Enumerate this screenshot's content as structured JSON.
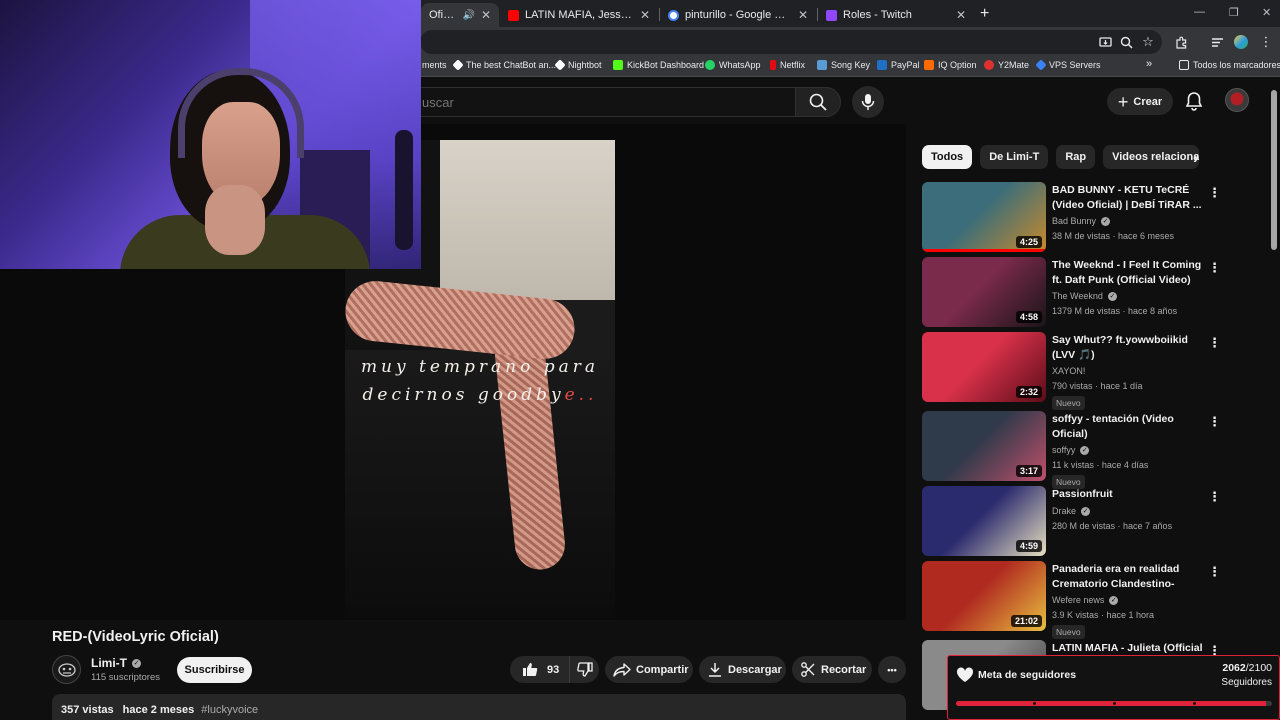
{
  "browser": {
    "tabs": [
      {
        "title": "Oficial) - Yo",
        "active": true,
        "fav_color": "#ff0000"
      },
      {
        "title": "LATIN MAFIA, Jesse Baez - Se fue",
        "active": false,
        "fav_color": "#ff0000"
      },
      {
        "title": "pinturillo - Google Search",
        "active": false,
        "fav_color": "#4285f4"
      },
      {
        "title": "Roles - Twitch",
        "active": false,
        "fav_color": "#9146ff"
      }
    ],
    "new_tab": "+",
    "window_controls": [
      "—",
      "❐",
      "✕"
    ],
    "bookmarks": [
      {
        "label": "ments",
        "color": "#35363a"
      },
      {
        "label": "The best ChatBot an...",
        "color": "#ffffff"
      },
      {
        "label": "Nightbot",
        "color": "#ffffff"
      },
      {
        "label": "KickBot Dashboard",
        "color": "#53fc18"
      },
      {
        "label": "WhatsApp",
        "color": "#25d366"
      },
      {
        "label": "Netflix",
        "color": "#e50914"
      },
      {
        "label": "Song Key",
        "color": "#5b9bd5"
      },
      {
        "label": "PayPal",
        "color": "#1f6fc5"
      },
      {
        "label": "IQ Option",
        "color": "#ff6b00"
      },
      {
        "label": "Y2Mate",
        "color": "#e03131"
      },
      {
        "label": "VPS Servers",
        "color": "#3b82f6"
      },
      {
        "label": "»",
        "color": "#35363a"
      },
      {
        "label": "Todos los marcadores",
        "color": "#35363a"
      }
    ]
  },
  "youtube": {
    "search_placeholder": "uscar",
    "create_label": "Crear",
    "album_text_line1": "muy temprano para",
    "album_text_line2": "decirnos goodby",
    "album_text_line2_red": "e..",
    "video_title": "RED-(VideoLyric Oficial)",
    "channel_name": "Limi-T",
    "channel_subs": "115 suscriptores",
    "subscribe_label": "Suscribirse",
    "like_count": "93",
    "actions": {
      "share": "Compartir",
      "download": "Descargar",
      "clip": "Recortar",
      "more": "•••"
    },
    "description": {
      "views": "357 vistas",
      "age": "hace 2 meses",
      "tag": "#luckyvoice"
    },
    "chips": [
      {
        "label": "Todos",
        "selected": true
      },
      {
        "label": "De Limi-T",
        "selected": false
      },
      {
        "label": "Rap",
        "selected": false
      },
      {
        "label": "Videos relacionados",
        "selected": false
      }
    ],
    "recommendations": [
      {
        "title": "BAD BUNNY - KETU TeCRÉ (Video Oficial) | DeBÍ TiRAR ...",
        "channel": "Bad Bunny",
        "verified": true,
        "meta": "38 M de vistas · hace 6 meses",
        "duration": "4:25",
        "badge": "",
        "thumb": "#3b6e7a",
        "thumb2": "#c98a2b",
        "watched": 1.0
      },
      {
        "title": "The Weeknd - I Feel It Coming ft. Daft Punk (Official Video)",
        "channel": "The Weeknd",
        "verified": true,
        "meta": "1379 M de vistas · hace 8 años",
        "duration": "4:58",
        "badge": "",
        "thumb": "#7a2a4a",
        "thumb2": "#1a1418",
        "watched": 0
      },
      {
        "title": "Say Whut?? ft.yowwboiikid (LVV 🎵)",
        "channel": "XAYON!",
        "verified": false,
        "meta": "790 vistas · hace 1 día",
        "duration": "2:32",
        "badge": "Nuevo",
        "thumb": "#d9314a",
        "thumb2": "#5a0d18",
        "watched": 0
      },
      {
        "title": "soffyy - tentación (Video Oficial)",
        "channel": "soffyy",
        "verified": true,
        "meta": "11 k vistas · hace 4 días",
        "duration": "3:17",
        "badge": "Nuevo",
        "thumb": "#2f3a4a",
        "thumb2": "#c0506a",
        "watched": 0
      },
      {
        "title": "Passionfruit",
        "channel": "Drake",
        "verified": true,
        "meta": "280 M de vistas · hace 7 años",
        "duration": "4:59",
        "badge": "",
        "thumb": "#2a2a6e",
        "thumb2": "#e8e0c0",
        "watched": 0
      },
      {
        "title": "Panaderia era en realidad Crematorio Clandestino-Mujer...",
        "channel": "Wefere news",
        "verified": true,
        "meta": "3.9 K vistas · hace 1 hora",
        "duration": "21:02",
        "badge": "Nuevo",
        "thumb": "#b02a20",
        "thumb2": "#e8c040",
        "watched": 0
      },
      {
        "title": "LATIN MAFIA - Julieta (Official",
        "channel": "",
        "verified": false,
        "meta": "",
        "duration": "",
        "badge": "",
        "thumb": "#8a8a8a",
        "thumb2": "#3a3a3a",
        "watched": 0
      }
    ]
  },
  "overlay": {
    "goal_label": "Meta de seguidores",
    "current": "2062",
    "target": "/2100",
    "unit": "Seguidores",
    "progress": 0.982,
    "accent": "#e0233a"
  }
}
